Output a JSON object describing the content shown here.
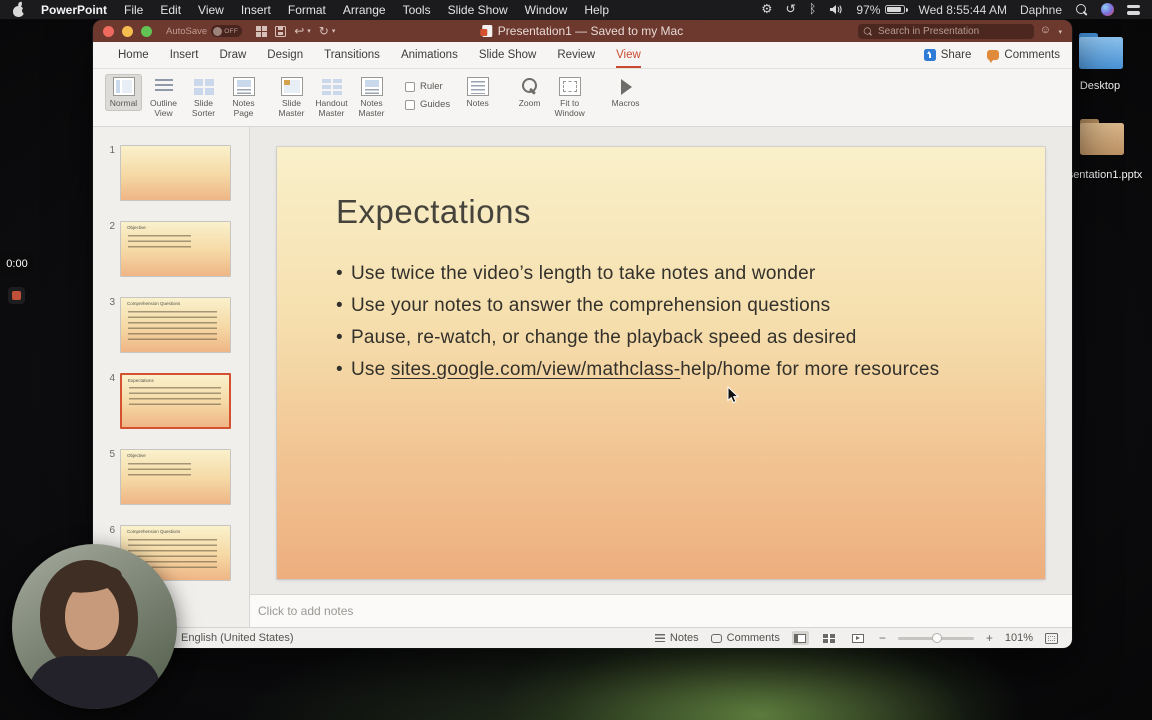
{
  "icons": {
    "gear": "⚙",
    "time_machine": "↺",
    "bluetooth": "ᛒ",
    "smiley": "☺",
    "chevron_down": "▾",
    "undo": "↩",
    "redo": "↻"
  },
  "colors": {
    "accent": "#c84b31",
    "selection_border": "#d4512f",
    "titlebar": "#6d382e"
  },
  "menu_bar": {
    "app_name": "PowerPoint",
    "items": [
      "File",
      "Edit",
      "View",
      "Insert",
      "Format",
      "Arrange",
      "Tools",
      "Slide Show",
      "Window",
      "Help"
    ],
    "battery": "97%",
    "clock": "Wed 8:55:44 AM",
    "user": "Daphne"
  },
  "titlebar": {
    "autosave_label": "AutoSave",
    "autosave_state": "OFF",
    "title": "Presentation1 — Saved to my Mac",
    "search_placeholder": "Search in Presentation"
  },
  "ribbon": {
    "tabs": [
      "Home",
      "Insert",
      "Draw",
      "Design",
      "Transitions",
      "Animations",
      "Slide Show",
      "Review",
      "View"
    ],
    "active_tab": "View",
    "share": "Share",
    "comments": "Comments",
    "buttons": {
      "normal": "Normal",
      "outline_view": "Outline View",
      "slide_sorter": "Slide Sorter",
      "notes_page": "Notes Page",
      "slide_master": "Slide Master",
      "handout_master": "Handout Master",
      "notes_master": "Notes Master",
      "ruler": "Ruler",
      "guides": "Guides",
      "notes": "Notes",
      "zoom": "Zoom",
      "fit_to_window": "Fit to Window",
      "macros": "Macros"
    }
  },
  "thumbnails": [
    {
      "number": "1",
      "title": ""
    },
    {
      "number": "2",
      "title": "Objective"
    },
    {
      "number": "3",
      "title": "Comprehension Questions"
    },
    {
      "number": "4",
      "title": "Expectations"
    },
    {
      "number": "5",
      "title": "Objective"
    },
    {
      "number": "6",
      "title": "Comprehension Questions"
    }
  ],
  "slide": {
    "title": "Expectations",
    "bullets": [
      {
        "pre": "Use twice the video’s length to take notes and wonder",
        "link": "",
        "post": ""
      },
      {
        "pre": "Use your notes to answer the comprehension questions",
        "link": "",
        "post": ""
      },
      {
        "pre": "Pause, re-watch, or change the playback speed as desired",
        "link": "",
        "post": ""
      },
      {
        "pre": "Use ",
        "link": "sites.google.com/view/mathclass-",
        "post": "help/home for more resources"
      }
    ]
  },
  "notes_pane": {
    "placeholder": "Click to add notes"
  },
  "status_bar": {
    "language": "English (United States)",
    "notes": "Notes",
    "comments": "Comments",
    "zoom_out": "−",
    "zoom_in": "+",
    "zoom_level": "101%"
  },
  "desktop": {
    "folder_label": "Desktop",
    "file_label": "sentation1.pptx",
    "timer": "0:00"
  }
}
